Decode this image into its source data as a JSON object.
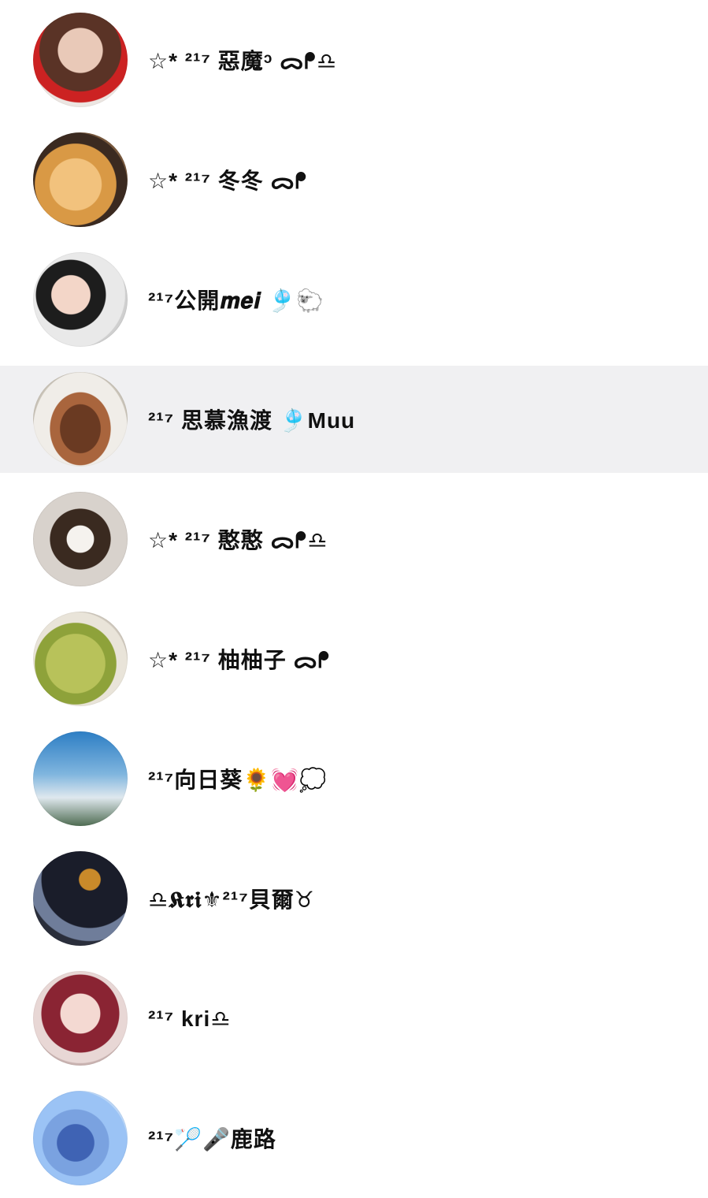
{
  "contacts": [
    {
      "name": "☆* ²¹⁷ 惡魔ᵓ ᯅᖰ♎"
    },
    {
      "name": "☆* ²¹⁷ 冬冬 ᯅᖰ"
    },
    {
      "name": "²¹⁷公開𝒎𝒆𝒊 🎐🐑"
    },
    {
      "name": "²¹⁷ 思慕漁渡 🎐Muu"
    },
    {
      "name": "☆* ²¹⁷ 憨憨 ᯅᖰ♎"
    },
    {
      "name": "☆* ²¹⁷ 柚柚子 ᯅᖰ"
    },
    {
      "name": "²¹⁷向日葵🌻💓💭"
    },
    {
      "name": "♎𝕶𝖗𝖎⚜²¹⁷貝爾♉"
    },
    {
      "name": "²¹⁷ kri♎"
    },
    {
      "name": "²¹⁷🏸🎤鹿路"
    }
  ],
  "selected_index": 3
}
